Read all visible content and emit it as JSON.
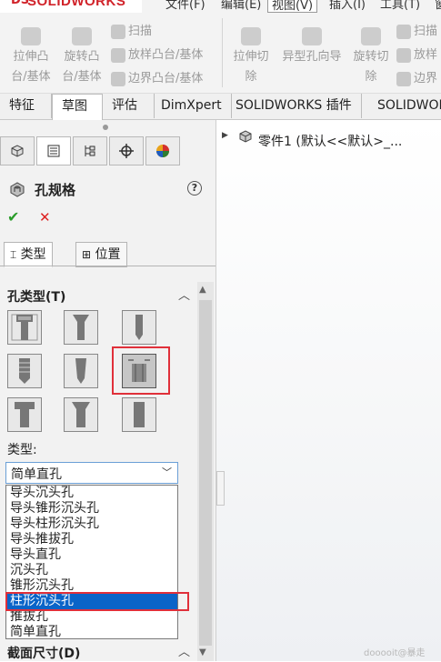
{
  "app": {
    "brand": "SOLIDWORKS",
    "brand_mark": "DS"
  },
  "menu": {
    "items": [
      "文件(F)",
      "编辑(E)",
      "视图(V)",
      "插入(I)",
      "工具(T)",
      "窗"
    ]
  },
  "ribbon": {
    "group1": [
      "拉伸凸",
      "台/基体",
      "旋转凸",
      "台/基体"
    ],
    "sweep": "扫描",
    "loft": "放样凸台/基体",
    "boundary": "边界凸台/基体",
    "cut_extrude": [
      "拉伸切",
      "除"
    ],
    "hole_wizard": "异型孔向导",
    "cut_revolve": [
      "旋转切",
      "除"
    ],
    "sweep2": "扫描",
    "loft2": "放样",
    "boundary2": "边界"
  },
  "tabs": [
    "特征",
    "草图",
    "评估",
    "DimXpert",
    "SOLIDWORKS 插件",
    "SOLIDWOR"
  ],
  "panel": {
    "title": "孔规格",
    "help": "?",
    "ok": "✔",
    "cancel": "✕",
    "tab_type": "类型",
    "tab_position": "位置",
    "section_hole_type": "孔类型(T)",
    "type_label": "类型:",
    "type_value": "简单直孔",
    "options": [
      "导头沉头孔",
      "导头锥形沉头孔",
      "导头柱形沉头孔",
      "导头推拔孔",
      "导头直孔",
      "沉头孔",
      "锥形沉头孔",
      "柱形沉头孔",
      "推拔孔",
      "简单直孔"
    ],
    "selected_option_index": 7,
    "section_bottom": "截面尺寸(D)"
  },
  "tree": {
    "label": "零件1 (默认<<默认>_..."
  },
  "watermark": "dooooit@暴走"
}
